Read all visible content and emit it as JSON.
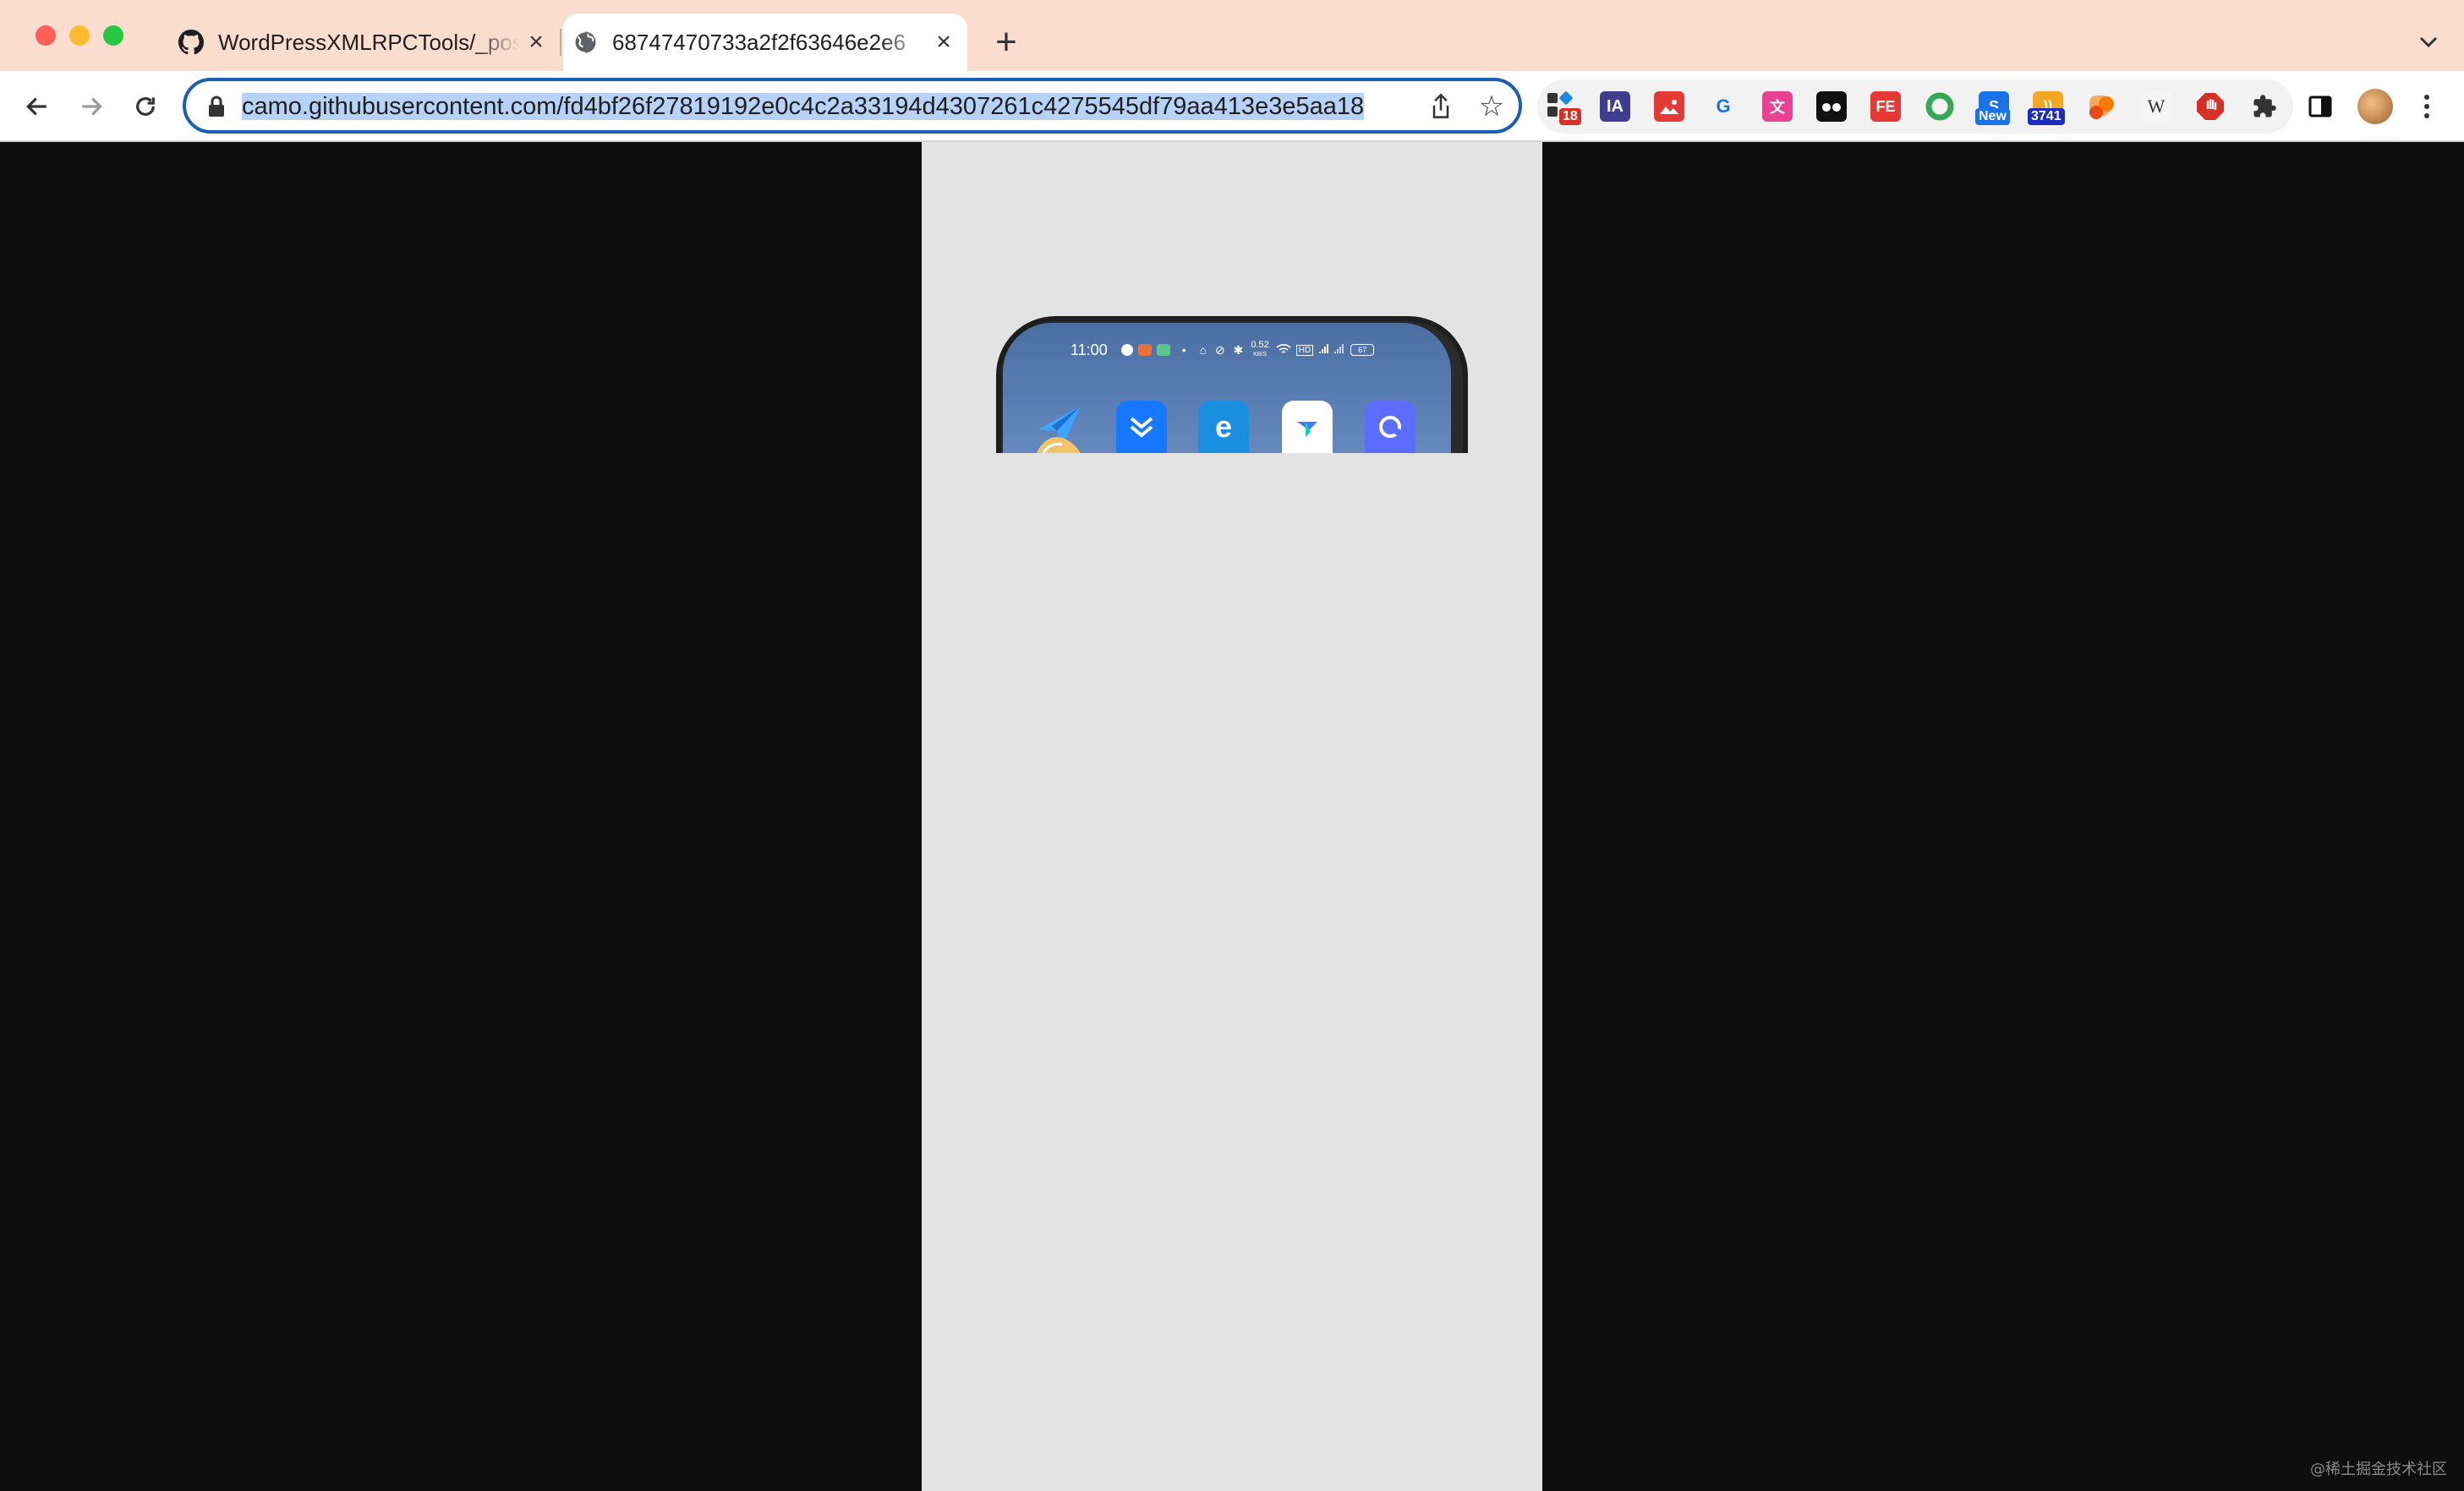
{
  "browser": {
    "tabs": [
      {
        "title": "WordPressXMLRPCTools/_post",
        "favicon": "github-icon"
      },
      {
        "title": "68747470733a2f2f63646e2e6",
        "favicon": "globe-icon"
      }
    ],
    "active_tab": 1,
    "address_bar": {
      "url": "camo.githubusercontent.com/fd4bf26f27819192e0c4c2a33194d4307261c4275545df79aa413e3e5aa18"
    },
    "extension_badges": {
      "extension_count": "18",
      "new": "New",
      "feed_count": "3741"
    }
  },
  "phone_preview": {
    "time": "11:00",
    "net_speed_value": "0.52",
    "net_speed_unit": "KB/S",
    "battery": "67"
  },
  "colors": {
    "titlebar": "#fbddd0",
    "accent": "#1a5fb4",
    "selection": "#b7d2f7"
  },
  "watermark": "@稀土掘金技术社区"
}
